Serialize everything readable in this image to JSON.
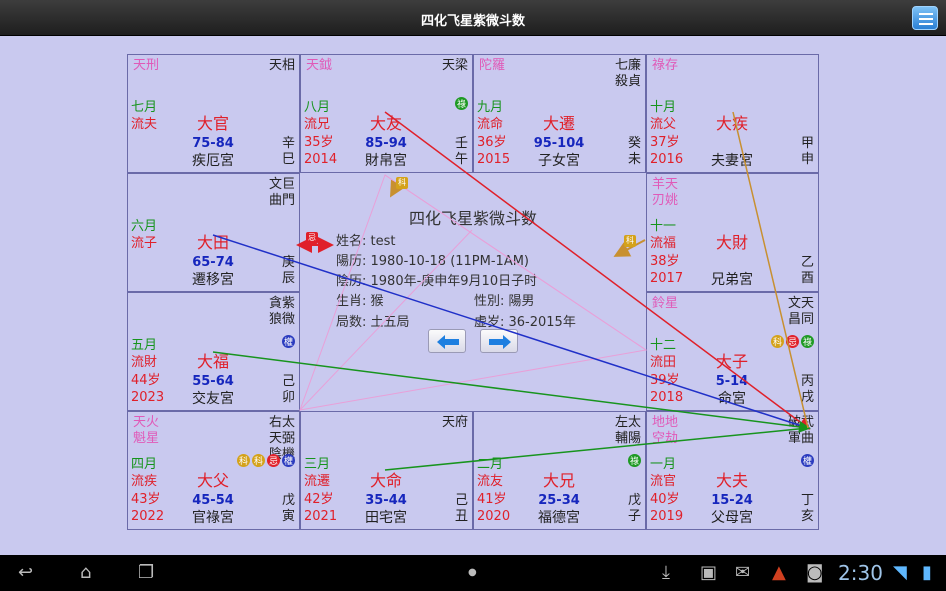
{
  "app": {
    "title": "四化飞星紫微斗数"
  },
  "cells": [
    {
      "id": "si",
      "stars_pink": "天刑",
      "stars_black": "天相",
      "month": "七月",
      "flow": "流夫",
      "age": "",
      "year": "",
      "palace": "大官",
      "range": "75-84",
      "pname": "疾厄宮",
      "stem": "辛巳",
      "badges": []
    },
    {
      "id": "wu",
      "stars_pink": "天鉞",
      "stars_black": "天梁",
      "month": "八月",
      "flow": "流兄",
      "age": "35岁",
      "year": "2014",
      "palace": "大友",
      "range": "85-94",
      "pname": "財帛宮",
      "stem": "壬午",
      "badges": [
        {
          "t": "祿",
          "c": "#1f9a24"
        }
      ]
    },
    {
      "id": "wei",
      "stars_pink": "陀羅",
      "stars_black": "七廉殺貞",
      "month": "九月",
      "flow": "流命",
      "age": "36岁",
      "year": "2015",
      "palace": "大遷",
      "range": "95-104",
      "pname": "子女宮",
      "stem": "癸未",
      "badges": []
    },
    {
      "id": "shen",
      "stars_pink": "祿存",
      "stars_black": "",
      "month": "十月",
      "flow": "流父",
      "age": "37岁",
      "year": "2016",
      "palace": "大疾",
      "range": "",
      "pname": "夫妻宮",
      "stem": "甲申",
      "badges": []
    },
    {
      "id": "chen",
      "stars_pink": "",
      "stars_black": "文巨曲門",
      "month": "六月",
      "flow": "流子",
      "age": "",
      "year": "",
      "palace": "大田",
      "range": "65-74",
      "pname": "遷移宮",
      "stem": "庚辰",
      "badges": []
    },
    {
      "id": "you",
      "stars_pink": "羊天刃姚",
      "stars_black": "",
      "month": "十一",
      "flow": "流福",
      "age": "38岁",
      "year": "2017",
      "palace": "大財",
      "range": "",
      "pname": "兄弟宮",
      "stem": "乙酉",
      "badges": []
    },
    {
      "id": "mao",
      "stars_pink": "",
      "stars_black": "貪紫狼微",
      "month": "五月",
      "flow": "流財",
      "age": "44岁",
      "year": "2023",
      "palace": "大福",
      "range": "55-64",
      "pname": "交友宮",
      "stem": "己卯",
      "badges": [
        {
          "t": "權",
          "c": "#2b3bbf"
        }
      ]
    },
    {
      "id": "xu",
      "stars_pink": "鈴星",
      "stars_black": "文天昌同",
      "month": "十二",
      "flow": "流田",
      "age": "39岁",
      "year": "2018",
      "palace": "大子",
      "range": "5-14",
      "pname": "命宮",
      "stem": "丙戌",
      "badges": [
        {
          "t": "科",
          "c": "#d4a21a"
        },
        {
          "t": "忌",
          "c": "#e0202a"
        },
        {
          "t": "祿",
          "c": "#1f9a24"
        }
      ]
    },
    {
      "id": "yin",
      "stars_pink": "天火魁星",
      "stars_black": "右太天弼陰機",
      "month": "四月",
      "flow": "流疾",
      "age": "43岁",
      "year": "2022",
      "palace": "大父",
      "range": "45-54",
      "pname": "官祿宮",
      "stem": "戊寅",
      "badges": [
        {
          "t": "科",
          "c": "#d4a21a"
        },
        {
          "t": "科",
          "c": "#d4a21a"
        },
        {
          "t": "忌",
          "c": "#e0202a"
        },
        {
          "t": "權",
          "c": "#2b3bbf"
        }
      ]
    },
    {
      "id": "chou",
      "stars_pink": "",
      "stars_black": "天府",
      "month": "三月",
      "flow": "流遷",
      "age": "42岁",
      "year": "2021",
      "palace": "大命",
      "range": "35-44",
      "pname": "田宅宮",
      "stem": "己丑",
      "badges": []
    },
    {
      "id": "zi",
      "stars_pink": "",
      "stars_black": "左太輔陽",
      "month": "二月",
      "flow": "流友",
      "age": "41岁",
      "year": "2020",
      "palace": "大兄",
      "range": "25-34",
      "pname": "福德宮",
      "stem": "戊子",
      "badges": [
        {
          "t": "祿",
          "c": "#1f9a24"
        }
      ]
    },
    {
      "id": "hai",
      "stars_pink": "地地空劫",
      "stars_black": "破武軍曲",
      "month": "一月",
      "flow": "流官",
      "age": "40岁",
      "year": "2019",
      "palace": "大夫",
      "range": "15-24",
      "pname": "父母宮",
      "stem": "丁亥",
      "badges": [
        {
          "t": "權",
          "c": "#2b3bbf"
        }
      ]
    }
  ],
  "center": {
    "title": "四化飞星紫微斗数",
    "name": "姓名: test",
    "solar": "陽历: 1980-10-18 (11PM-1AM)",
    "lunar": "陰历: 1980年-庚申年9月10日子时",
    "zodiac": "生肖: 猴",
    "gender": "性別: 陽男",
    "bureau": "局数: 土五局",
    "age": "虚岁: 36-2015年",
    "tag_ji": "忌",
    "tag_ke": "科",
    "tag_ke2": "科"
  },
  "system": {
    "clock": "2:30"
  }
}
